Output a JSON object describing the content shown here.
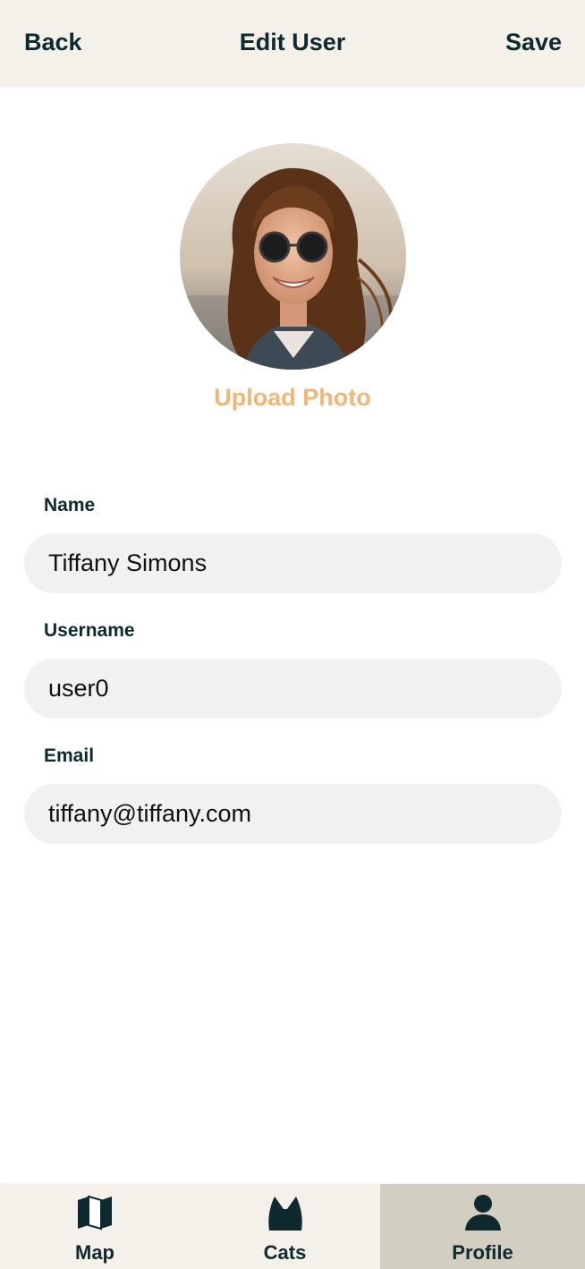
{
  "header": {
    "back_label": "Back",
    "title": "Edit User",
    "save_label": "Save"
  },
  "profile": {
    "upload_label": "Upload Photo"
  },
  "form": {
    "name": {
      "label": "Name",
      "value": "Tiffany Simons"
    },
    "username": {
      "label": "Username",
      "value": "user0"
    },
    "email": {
      "label": "Email",
      "value": "tiffany@tiffany.com"
    }
  },
  "nav": {
    "items": [
      {
        "label": "Map",
        "icon": "map-icon"
      },
      {
        "label": "Cats",
        "icon": "cat-icon"
      },
      {
        "label": "Profile",
        "icon": "person-icon",
        "active": true
      }
    ]
  },
  "colors": {
    "header_bg": "#f4f1ea",
    "text_dark": "#0f2a2e",
    "accent_orange": "#f3b574",
    "input_bg": "#f1f1f1",
    "nav_active_bg": "#d2cfc2"
  }
}
